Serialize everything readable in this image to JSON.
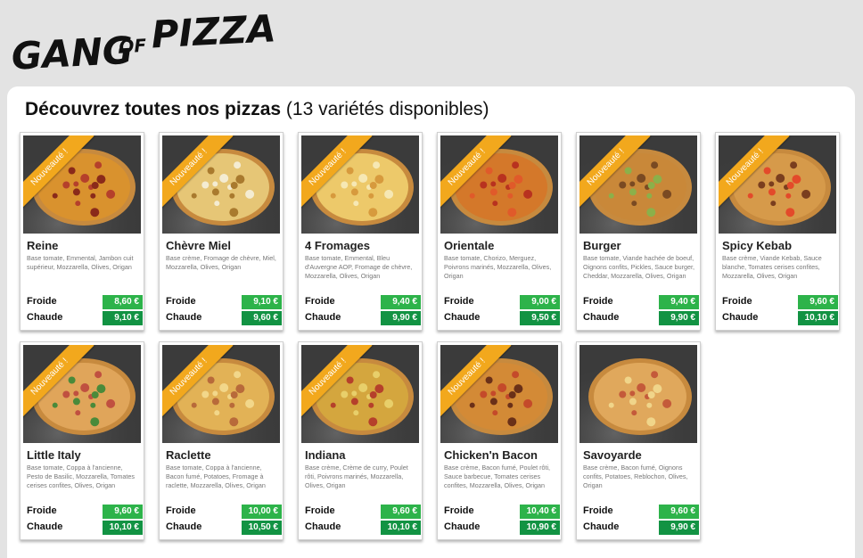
{
  "logo": {
    "text_left": "GANG",
    "text_of": "OF",
    "text_right": "PIZZA"
  },
  "heading": {
    "bold": "Découvrez toutes nos pizzas",
    "count": "(13 variétés disponibles)"
  },
  "labels": {
    "froide": "Froide",
    "chaude": "Chaude"
  },
  "badge_text": "Nouveauté !",
  "colors": {
    "froide_bg": "#2db34a",
    "chaude_bg": "#129343",
    "ribbon": "#f2a81d"
  },
  "pizzas": [
    {
      "name": "Reine",
      "desc": "Base tomate, Emmental, Jambon cuit supérieur, Mozzarella, Olives, Origan",
      "froide": "8,60 €",
      "chaude": "9,10 €",
      "new": true
    },
    {
      "name": "Chèvre Miel",
      "desc": "Base crème, Fromage de chèvre, Miel, Mozzarella, Olives, Origan",
      "froide": "9,10 €",
      "chaude": "9,60 €",
      "new": true
    },
    {
      "name": "4 Fromages",
      "desc": "Base tomate, Emmental, Bleu d'Auvergne AOP, Fromage de chèvre, Mozzarella, Olives, Origan",
      "froide": "9,40 €",
      "chaude": "9,90 €",
      "new": true
    },
    {
      "name": "Orientale",
      "desc": "Base tomate, Chorizo, Merguez, Poivrons marinés, Mozzarella, Olives, Origan",
      "froide": "9,00 €",
      "chaude": "9,50 €",
      "new": true
    },
    {
      "name": "Burger",
      "desc": "Base tomate, Viande hachée de boeuf, Oignons confits, Pickles, Sauce burger, Cheddar, Mozzarella, Olives, Origan",
      "froide": "9,40 €",
      "chaude": "9,90 €",
      "new": true
    },
    {
      "name": "Spicy Kebab",
      "desc": "Base crème, Viande Kebab, Sauce blanche, Tomates cerises confites, Mozzarella, Olives, Origan",
      "froide": "9,60 €",
      "chaude": "10,10 €",
      "new": true
    },
    {
      "name": "Little Italy",
      "desc": "Base tomate, Coppa à l'ancienne, Pesto de Basilic, Mozzarella, Tomates cerises confites, Olives, Origan",
      "froide": "9,60 €",
      "chaude": "10,10 €",
      "new": true
    },
    {
      "name": "Raclette",
      "desc": "Base tomate, Coppa à l'ancienne, Bacon fumé, Potatoes, Fromage à raclette, Mozzarella, Olives, Origan",
      "froide": "10,00 €",
      "chaude": "10,50 €",
      "new": true
    },
    {
      "name": "Indiana",
      "desc": "Base crème, Crème de curry, Poulet rôti, Poivrons marinés, Mozzarella, Olives, Origan",
      "froide": "9,60 €",
      "chaude": "10,10 €",
      "new": true
    },
    {
      "name": "Chicken'n Bacon",
      "desc": "Base crème, Bacon fumé, Poulet rôti, Sauce barbecue, Tomates cerises confites, Mozzarella, Olives, Origan",
      "froide": "10,40 €",
      "chaude": "10,90 €",
      "new": true
    },
    {
      "name": "Savoyarde",
      "desc": "Base crème, Bacon fumé, Oignons confits, Potatoes, Reblochon, Olives, Origan",
      "froide": "9,60 €",
      "chaude": "9,90 €",
      "new": false
    }
  ]
}
